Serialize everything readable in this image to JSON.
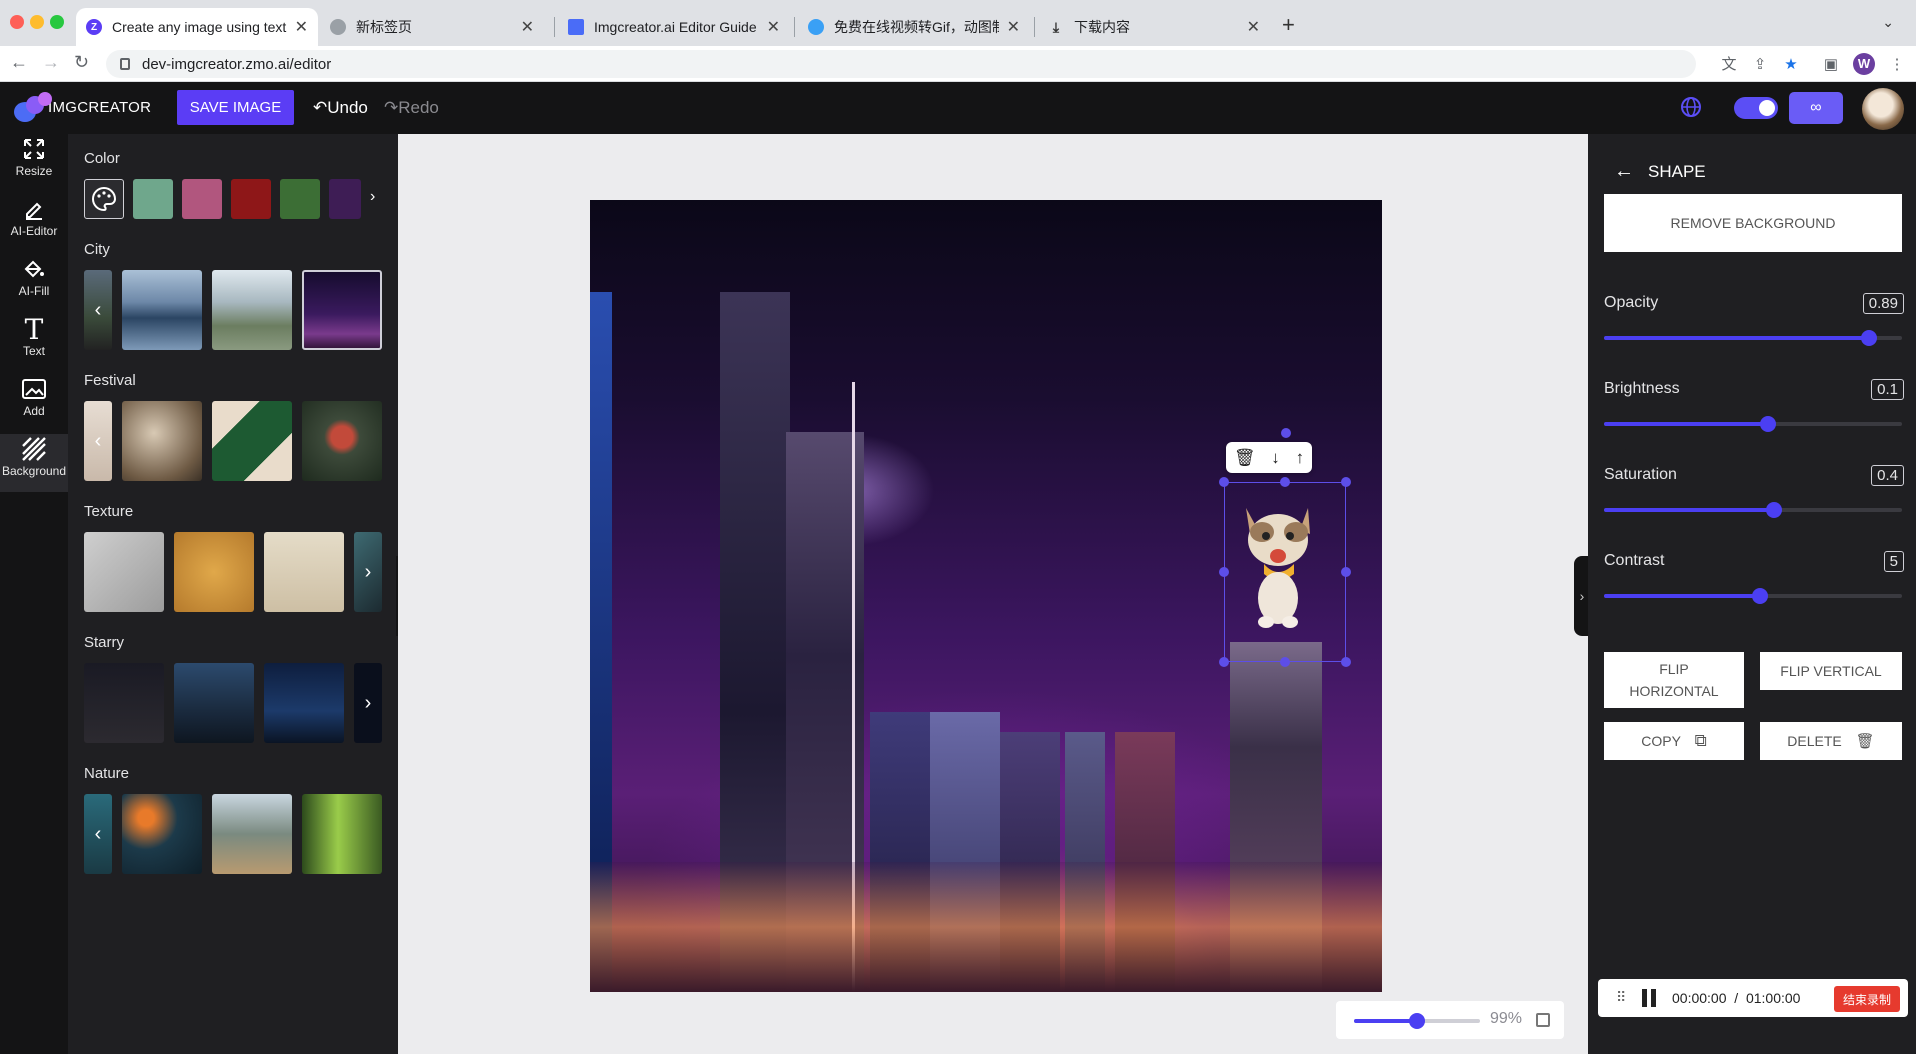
{
  "browser": {
    "tabs": [
      {
        "title": "Create any image using text | I",
        "active": true
      },
      {
        "title": "新标签页",
        "active": false
      },
      {
        "title": "Imgcreator.ai Editor Guide - “",
        "active": false
      },
      {
        "title": "免费在线视频转Gif，动图制作一",
        "active": false
      },
      {
        "title": "下载内容",
        "active": false
      }
    ],
    "new_tab": "+",
    "url": "dev-imgcreator.zmo.ai/editor",
    "profile_initial": "W"
  },
  "header": {
    "logo_text": "IMGCREATOR",
    "save_label": "SAVE IMAGE",
    "undo_label": "Undo",
    "redo_label": "Redo"
  },
  "rail": [
    {
      "label": "Resize",
      "icon": "resize-icon"
    },
    {
      "label": "AI-Editor",
      "icon": "pen-icon"
    },
    {
      "label": "AI-Fill",
      "icon": "bucket-icon"
    },
    {
      "label": "Text",
      "icon": "text-icon"
    },
    {
      "label": "Add",
      "icon": "image-add-icon"
    },
    {
      "label": "Background",
      "icon": "stripes-icon"
    }
  ],
  "assets": {
    "sections": [
      {
        "title": "Color"
      },
      {
        "title": "City"
      },
      {
        "title": "Festival"
      },
      {
        "title": "Texture"
      },
      {
        "title": "Starry"
      },
      {
        "title": "Nature"
      }
    ],
    "color_swatches": [
      "#6fa78c",
      "#b1567e",
      "#8e1718",
      "#3c6e35",
      "#3e1d55"
    ]
  },
  "canvas": {
    "zoom_label": "99%",
    "zoom_fraction": 0.5
  },
  "props": {
    "title": "SHAPE",
    "remove_bg_label": "REMOVE BACKGROUND",
    "sliders": [
      {
        "label": "Opacity",
        "value": "0.89",
        "fraction": 0.89
      },
      {
        "label": "Brightness",
        "value": "0.1",
        "fraction": 0.55
      },
      {
        "label": "Saturation",
        "value": "0.4",
        "fraction": 0.57
      },
      {
        "label": "Contrast",
        "value": "5",
        "fraction": 0.525
      }
    ],
    "flip_h_label": "FLIP\nHORIZONTAL",
    "flip_v_label": "FLIP VERTICAL",
    "copy_label": "COPY",
    "delete_label": "DELETE"
  },
  "recorder": {
    "time": "00:00:00  /  01:00:00",
    "stop_label": "结束录制"
  },
  "colors": {
    "accent": "#5b3df5",
    "slider": "#4b3ff2",
    "record": "#e63a2e"
  }
}
